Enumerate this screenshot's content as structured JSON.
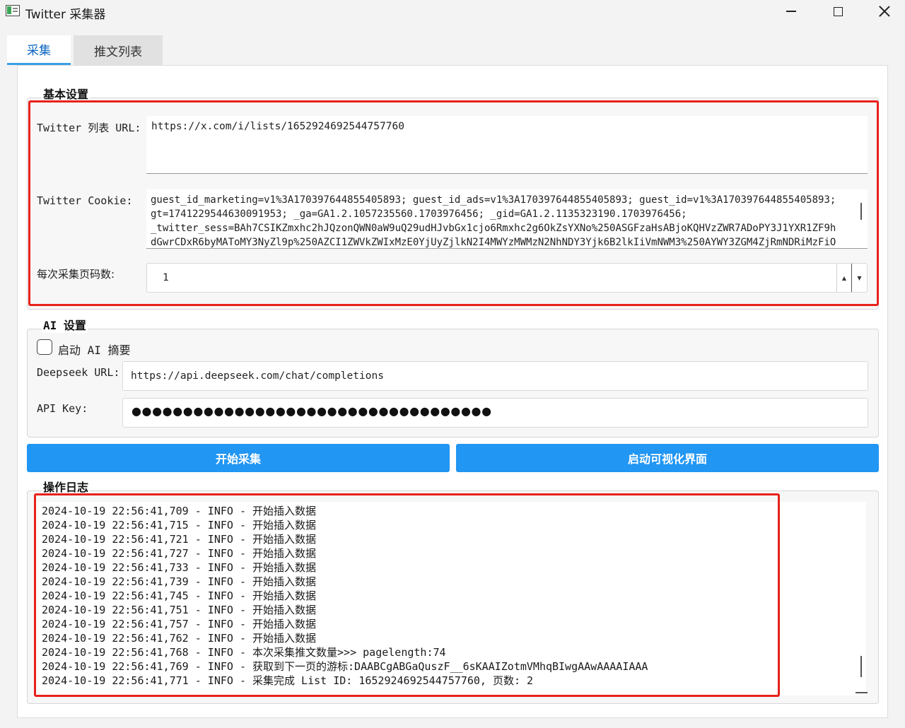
{
  "window": {
    "title": "Twitter 采集器"
  },
  "tabs": [
    {
      "label": "采集",
      "active": true
    },
    {
      "label": "推文列表",
      "active": false
    }
  ],
  "basic_settings": {
    "title": "基本设置",
    "list_url_label": "Twitter 列表 URL:",
    "list_url_value": "https://x.com/i/lists/1652924692544757760",
    "cookie_label": "Twitter Cookie:",
    "cookie_lines": [
      "guest_id_marketing=v1%3A170397644855405893; guest_id_ads=v1%3A170397644855405893; guest_id=v1%3A170397644855405893;",
      "gt=1741229544630091953; _ga=GA1.2.1057235560.1703976456; _gid=GA1.2.1135323190.1703976456;",
      "_twitter_sess=BAh7CSIKZmxhc2hJQzonQWN0aW9uQ29udHJvbGx1cjo6Rmxhc2g6OkZsYXNo%250ASGFzaHsABjoKQHVzZWR7ADoPY3J1YXR1ZF9h",
      "dGwrCDxR6byMAToMY3NyZl9p%250AZCI1ZWVkZWIxMzE0YjUyZjlkN2I4MWYzMWMzN2NhNDY3Yjk6B2lkIiVmNWM3%250AYWY3ZGM4ZjRmNDRiMzFiO"
    ],
    "pages_label": "每次采集页码数:",
    "pages_value": "1"
  },
  "ai_settings": {
    "title": "AI 设置",
    "enable_label": "启动 AI 摘要",
    "enable_checked": false,
    "deepseek_url_label": "Deepseek URL:",
    "deepseek_url_value": "https://api.deepseek.com/chat/completions",
    "api_key_label": "API Key:",
    "api_key_value": "●●●●●●●●●●●●●●●●●●●●●●●●●●●●●●●●●●●"
  },
  "buttons": {
    "start": "开始采集",
    "visual": "启动可视化界面"
  },
  "log": {
    "title": "操作日志",
    "lines": [
      "2024-10-19 22:56:41,709 - INFO - 开始插入数据",
      "2024-10-19 22:56:41,715 - INFO - 开始插入数据",
      "2024-10-19 22:56:41,721 - INFO - 开始插入数据",
      "2024-10-19 22:56:41,727 - INFO - 开始插入数据",
      "2024-10-19 22:56:41,733 - INFO - 开始插入数据",
      "2024-10-19 22:56:41,739 - INFO - 开始插入数据",
      "2024-10-19 22:56:41,745 - INFO - 开始插入数据",
      "2024-10-19 22:56:41,751 - INFO - 开始插入数据",
      "2024-10-19 22:56:41,757 - INFO - 开始插入数据",
      "2024-10-19 22:56:41,762 - INFO - 开始插入数据",
      "2024-10-19 22:56:41,768 - INFO - 本次采集推文数量>>> pagelength:74",
      "2024-10-19 22:56:41,769 - INFO - 获取到下一页的游标:DAABCgABGaQuszF__6sKAAIZotmVMhqBIwgAAwAAAAIAAA",
      "2024-10-19 22:56:41,771 - INFO - 采集完成 List ID: 1652924692544757760, 页数: 2"
    ]
  }
}
